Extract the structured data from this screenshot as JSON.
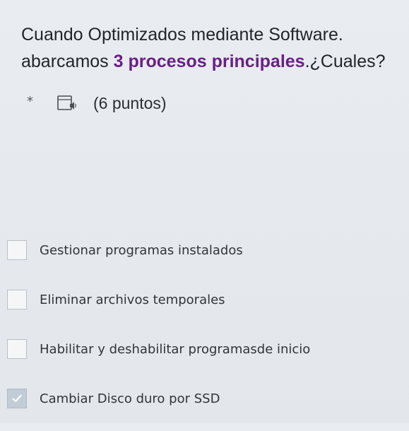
{
  "question": {
    "line1": "Cuando Optimizados mediante Software.",
    "line2_prefix": "abarcamos ",
    "line2_bold": "3 procesos  principales",
    "line2_suffix": ".¿Cuales?"
  },
  "meta": {
    "required_mark": "*",
    "reader_icon": "immersive-reader-icon",
    "points": "(6 puntos)"
  },
  "options": [
    {
      "label": "Gestionar programas instalados",
      "checked": false
    },
    {
      "label": "Eliminar archivos temporales",
      "checked": false
    },
    {
      "label": "Habilitar y deshabilitar programasde inicio",
      "checked": false
    },
    {
      "label": "Cambiar Disco duro por SSD",
      "checked": true
    }
  ],
  "colors": {
    "emphasis": "#6a1f86",
    "checkbox_checked": "#c1ccd6",
    "background": "#e6eaee"
  }
}
